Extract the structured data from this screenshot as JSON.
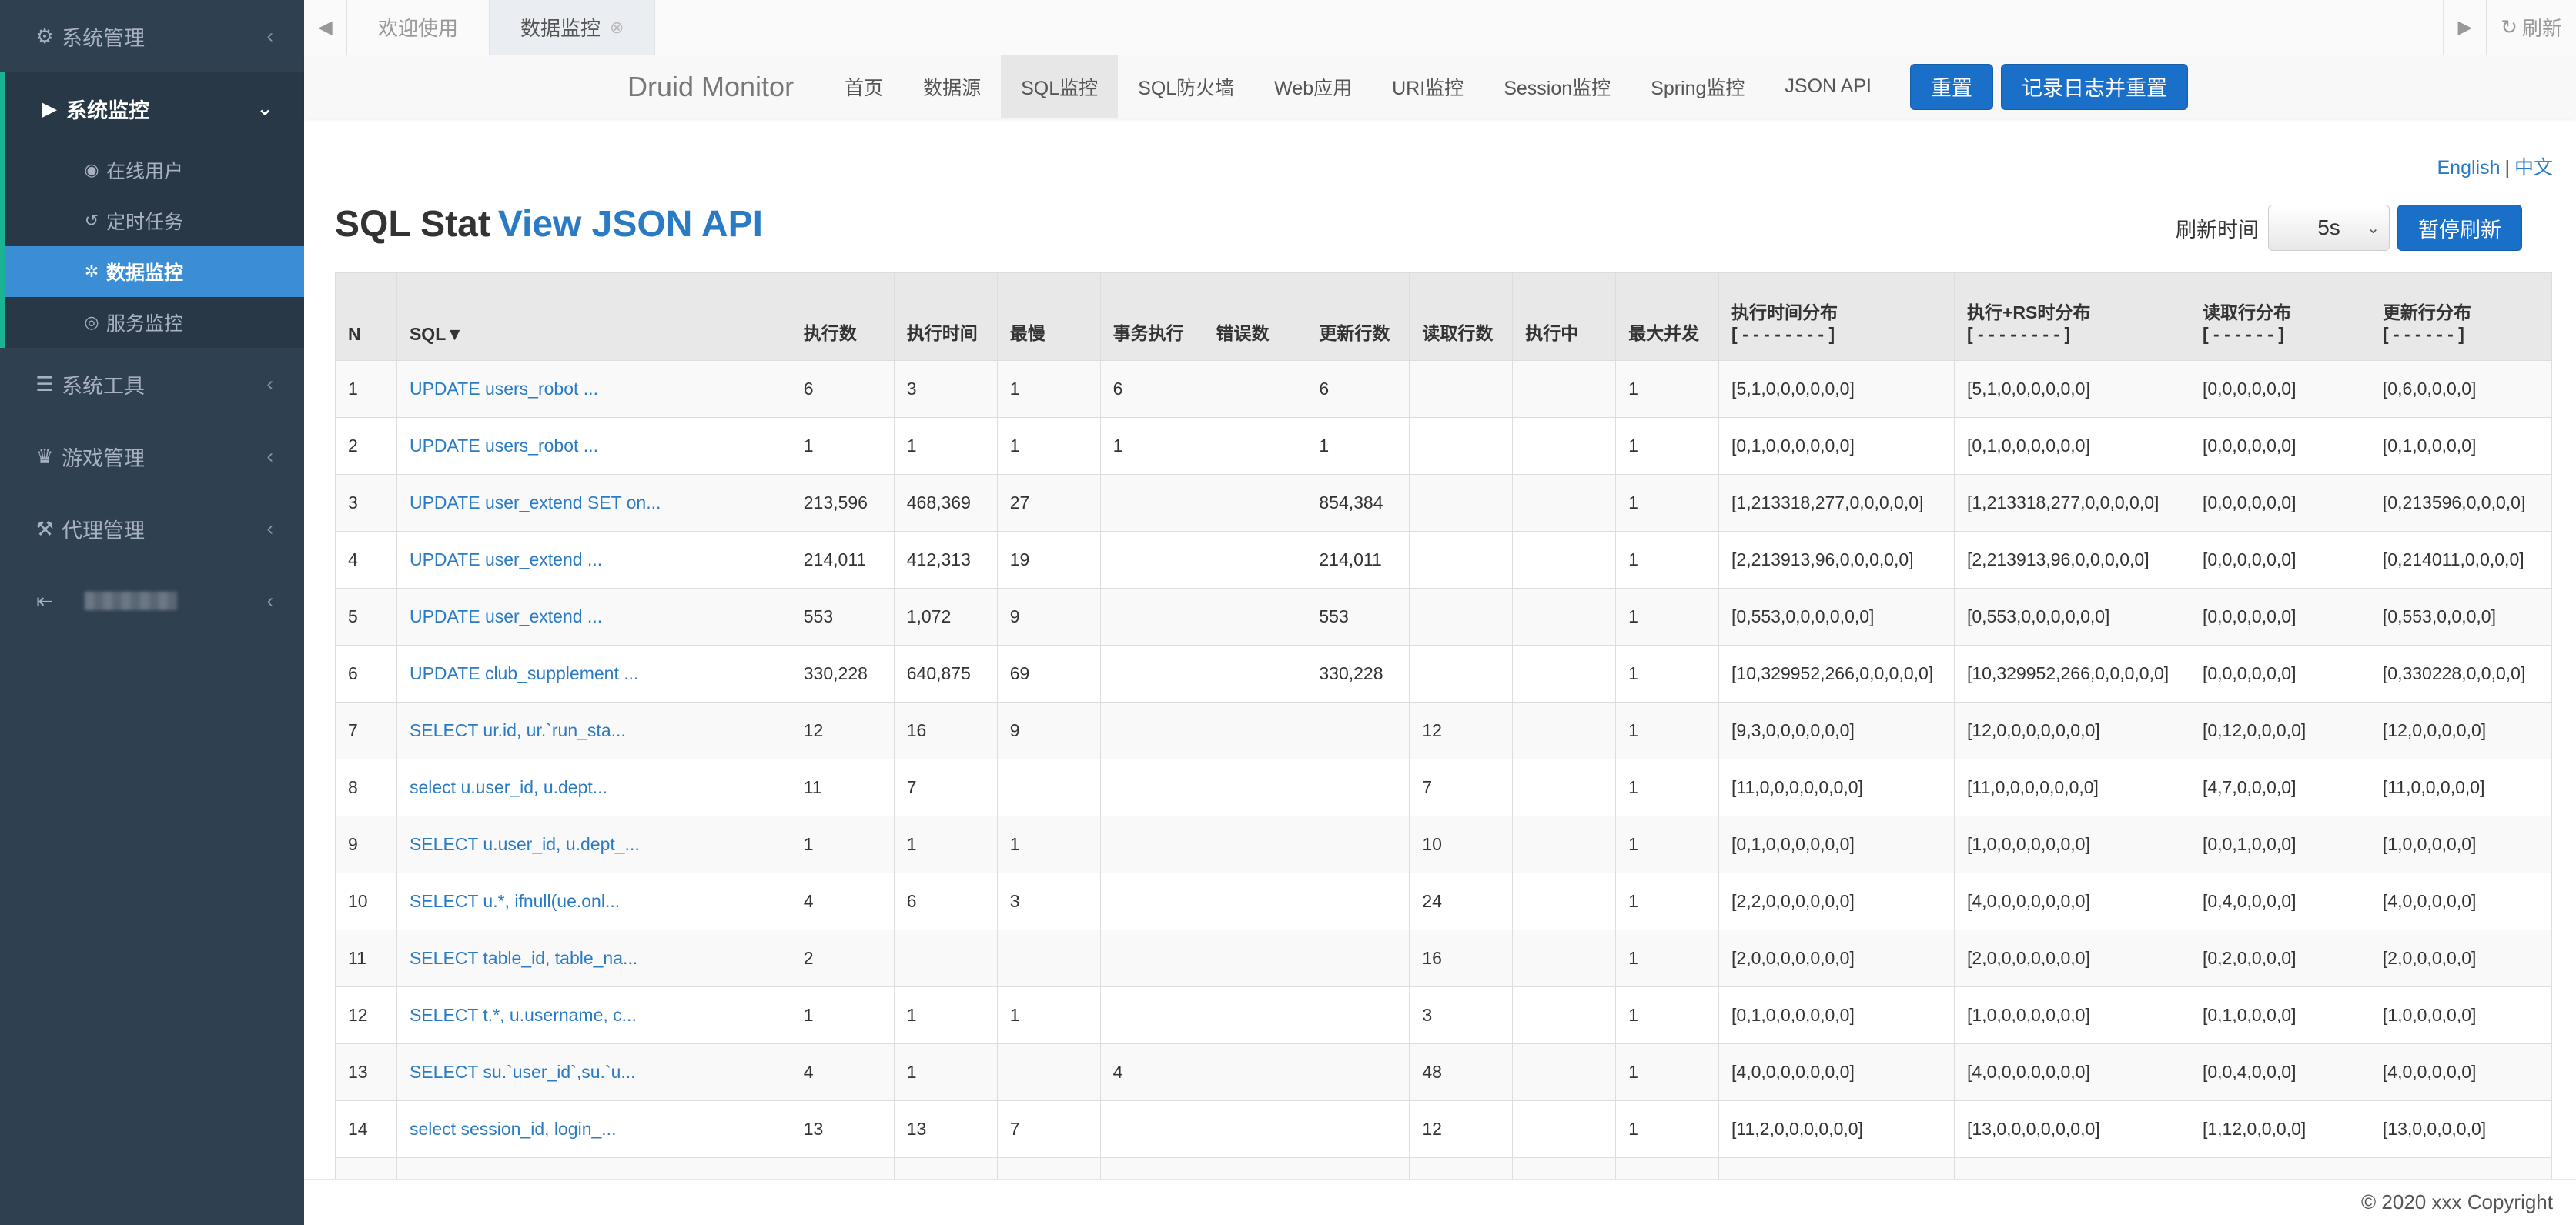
{
  "sidebar": {
    "items": [
      {
        "label": "系统管理",
        "icon": "gear-icon",
        "chev": "‹"
      },
      {
        "label": "系统监控",
        "icon": "video-icon",
        "chev": "⌄",
        "sub": [
          {
            "label": "在线用户",
            "icon": "user-circle-icon"
          },
          {
            "label": "定时任务",
            "icon": "history-icon"
          },
          {
            "label": "数据监控",
            "icon": "bug-icon"
          },
          {
            "label": "服务监控",
            "icon": "target-icon"
          }
        ]
      },
      {
        "label": "系统工具",
        "icon": "bars-icon",
        "chev": "‹"
      },
      {
        "label": "游戏管理",
        "icon": "trophy-icon",
        "chev": "‹"
      },
      {
        "label": "代理管理",
        "icon": "gavel-icon",
        "chev": "‹"
      },
      {
        "label": "",
        "icon": "signout-icon",
        "chev": "‹"
      }
    ]
  },
  "tabs": {
    "items": [
      "欢迎使用",
      "数据监控"
    ],
    "close": "⊗",
    "refresh": "刷新"
  },
  "druid_nav": {
    "brand": "Druid Monitor",
    "links": [
      "首页",
      "数据源",
      "SQL监控",
      "SQL防火墙",
      "Web应用",
      "URI监控",
      "Session监控",
      "Spring监控",
      "JSON API"
    ],
    "active": "SQL监控",
    "reset": "重置",
    "log_reset": "记录日志并重置"
  },
  "lang": {
    "en": "English",
    "sep": "|",
    "zh": "中文"
  },
  "page": {
    "title": "SQL Stat",
    "json_link": "View JSON API",
    "refresh_label": "刷新时间",
    "refresh_value": "5s",
    "pause": "暂停刷新"
  },
  "table": {
    "headers": [
      "N",
      "SQL▼",
      "执行数",
      "执行时间",
      "最慢",
      "事务执行",
      "错误数",
      "更新行数",
      "读取行数",
      "执行中",
      "最大并发",
      "执行时间分布",
      "执行+RS时分布",
      "读取行分布",
      "更新行分布"
    ],
    "dist_headers": {
      "执行时间分布": "[ - - - - - - - - ]",
      "执行+RS时分布": "[ - - - - - - - - ]",
      "读取行分布": "[ - - - - - - ]",
      "更新行分布": "[ - - - - - - ]"
    },
    "rows": [
      [
        "1",
        "UPDATE users_robot ...",
        "6",
        "3",
        "1",
        "6",
        "",
        "6",
        "",
        "",
        "1",
        "[5,1,0,0,0,0,0,0]",
        "[5,1,0,0,0,0,0,0]",
        "[0,0,0,0,0,0]",
        "[0,6,0,0,0,0]"
      ],
      [
        "2",
        "UPDATE users_robot ...",
        "1",
        "1",
        "1",
        "1",
        "",
        "1",
        "",
        "",
        "1",
        "[0,1,0,0,0,0,0,0]",
        "[0,1,0,0,0,0,0,0]",
        "[0,0,0,0,0,0]",
        "[0,1,0,0,0,0]"
      ],
      [
        "3",
        "UPDATE user_extend SET on...",
        "213,596",
        "468,369",
        "27",
        "",
        "",
        "854,384",
        "",
        "",
        "1",
        "[1,213318,277,0,0,0,0,0]",
        "[1,213318,277,0,0,0,0,0]",
        "[0,0,0,0,0,0]",
        "[0,213596,0,0,0,0]"
      ],
      [
        "4",
        "UPDATE user_extend ...",
        "214,011",
        "412,313",
        "19",
        "",
        "",
        "214,011",
        "",
        "",
        "1",
        "[2,213913,96,0,0,0,0,0]",
        "[2,213913,96,0,0,0,0,0]",
        "[0,0,0,0,0,0]",
        "[0,214011,0,0,0,0]"
      ],
      [
        "5",
        "UPDATE user_extend ...",
        "553",
        "1,072",
        "9",
        "",
        "",
        "553",
        "",
        "",
        "1",
        "[0,553,0,0,0,0,0,0]",
        "[0,553,0,0,0,0,0,0]",
        "[0,0,0,0,0,0]",
        "[0,553,0,0,0,0]"
      ],
      [
        "6",
        "UPDATE club_supplement ...",
        "330,228",
        "640,875",
        "69",
        "",
        "",
        "330,228",
        "",
        "",
        "1",
        "[10,329952,266,0,0,0,0,0]",
        "[10,329952,266,0,0,0,0,0]",
        "[0,0,0,0,0,0]",
        "[0,330228,0,0,0,0]"
      ],
      [
        "7",
        "SELECT ur.id, ur.`run_sta...",
        "12",
        "16",
        "9",
        "",
        "",
        "",
        "12",
        "",
        "1",
        "[9,3,0,0,0,0,0,0]",
        "[12,0,0,0,0,0,0,0]",
        "[0,12,0,0,0,0]",
        "[12,0,0,0,0,0]"
      ],
      [
        "8",
        "select u.user_id, u.dept...",
        "11",
        "7",
        "",
        "",
        "",
        "",
        "7",
        "",
        "1",
        "[11,0,0,0,0,0,0,0]",
        "[11,0,0,0,0,0,0,0]",
        "[4,7,0,0,0,0]",
        "[11,0,0,0,0,0]"
      ],
      [
        "9",
        "SELECT u.user_id, u.dept_...",
        "1",
        "1",
        "1",
        "",
        "",
        "",
        "10",
        "",
        "1",
        "[0,1,0,0,0,0,0,0]",
        "[1,0,0,0,0,0,0,0]",
        "[0,0,1,0,0,0]",
        "[1,0,0,0,0,0]"
      ],
      [
        "10",
        "SELECT u.*, ifnull(ue.onl...",
        "4",
        "6",
        "3",
        "",
        "",
        "",
        "24",
        "",
        "1",
        "[2,2,0,0,0,0,0,0]",
        "[4,0,0,0,0,0,0,0]",
        "[0,4,0,0,0,0]",
        "[4,0,0,0,0,0]"
      ],
      [
        "11",
        "SELECT table_id, table_na...",
        "2",
        "",
        "",
        "",
        "",
        "",
        "16",
        "",
        "1",
        "[2,0,0,0,0,0,0,0]",
        "[2,0,0,0,0,0,0,0]",
        "[0,2,0,0,0,0]",
        "[2,0,0,0,0,0]"
      ],
      [
        "12",
        "SELECT t.*, u.username, c...",
        "1",
        "1",
        "1",
        "",
        "",
        "",
        "3",
        "",
        "1",
        "[0,1,0,0,0,0,0,0]",
        "[1,0,0,0,0,0,0,0]",
        "[0,1,0,0,0,0]",
        "[1,0,0,0,0,0]"
      ],
      [
        "13",
        "SELECT su.`user_id`,su.`u...",
        "4",
        "1",
        "",
        "4",
        "",
        "",
        "48",
        "",
        "1",
        "[4,0,0,0,0,0,0,0]",
        "[4,0,0,0,0,0,0,0]",
        "[0,0,4,0,0,0]",
        "[4,0,0,0,0,0]"
      ],
      [
        "14",
        "select session_id, login_...",
        "13",
        "13",
        "7",
        "",
        "",
        "",
        "12",
        "",
        "1",
        "[11,2,0,0,0,0,0,0]",
        "[13,0,0,0,0,0,0,0]",
        "[1,12,0,0,0,0]",
        "[13,0,0,0,0,0]"
      ],
      [
        "",
        "",
        "",
        "",
        "",
        "",
        "",
        "",
        "",
        "",
        "",
        "",
        "",
        "",
        ""
      ]
    ]
  },
  "footer": {
    "copyright": "© 2020 xxx Copyright"
  }
}
